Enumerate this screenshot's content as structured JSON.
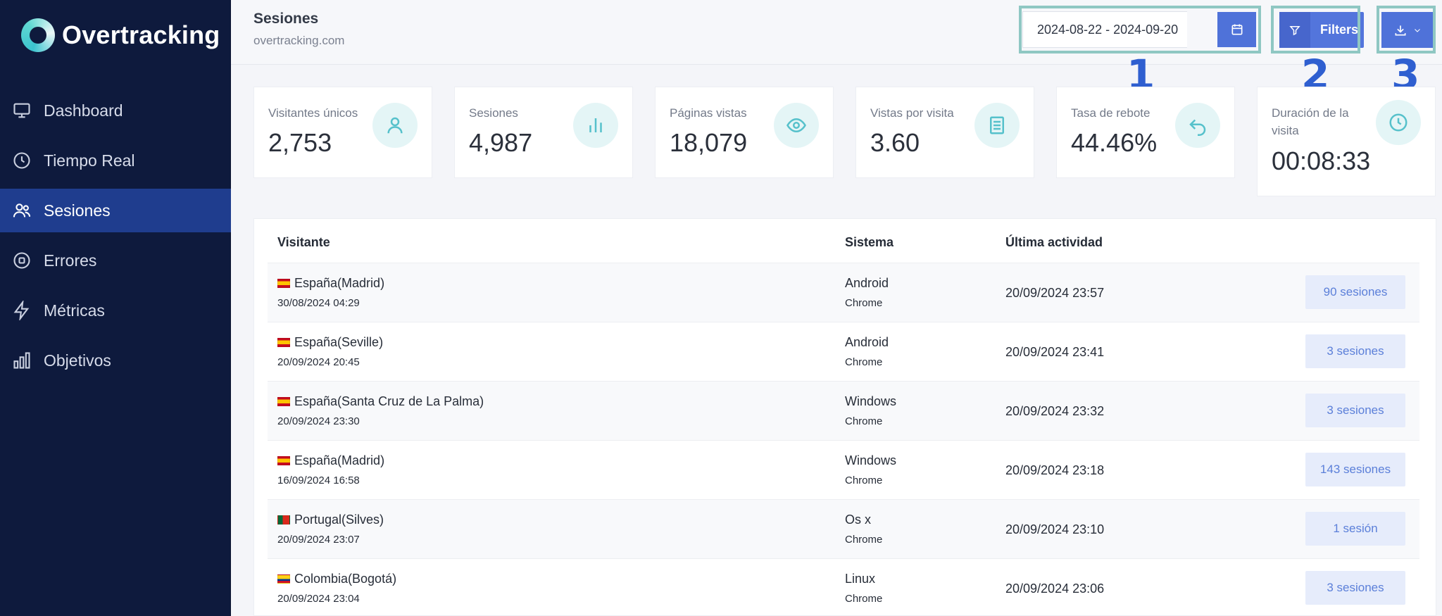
{
  "app": {
    "name": "Overtracking"
  },
  "sidebar": {
    "items": [
      {
        "label": "Dashboard",
        "icon": "monitor-icon"
      },
      {
        "label": "Tiempo Real",
        "icon": "clock-icon"
      },
      {
        "label": "Sesiones",
        "icon": "users-icon",
        "active": true
      },
      {
        "label": "Errores",
        "icon": "stop-circle-icon"
      },
      {
        "label": "Métricas",
        "icon": "lightning-icon"
      },
      {
        "label": "Objetivos",
        "icon": "bar-chart-icon"
      }
    ]
  },
  "header": {
    "title": "Sesiones",
    "subtitle": "overtracking.com",
    "date_range": "2024-08-22 - 2024-09-20",
    "filters_label": "Filters",
    "callouts": [
      "1",
      "2",
      "3"
    ]
  },
  "stats": [
    {
      "label": "Visitantes únicos",
      "value": "2,753",
      "icon": "user-icon"
    },
    {
      "label": "Sesiones",
      "value": "4,987",
      "icon": "bar-chart-icon"
    },
    {
      "label": "Páginas vistas",
      "value": "18,079",
      "icon": "eye-icon"
    },
    {
      "label": "Vistas por visita",
      "value": "3.60",
      "icon": "document-icon"
    },
    {
      "label": "Tasa de rebote",
      "value": "44.46%",
      "icon": "undo-icon"
    },
    {
      "label": "Duración de la visita",
      "value": "00:08:33",
      "icon": "clock-icon"
    }
  ],
  "table": {
    "headers": [
      "Visitante",
      "Sistema",
      "Última actividad"
    ],
    "rows": [
      {
        "flag": "es",
        "visitor": "España(Madrid)",
        "first_seen": "30/08/2024 04:29",
        "os": "Android",
        "browser": "Chrome",
        "last_activity": "20/09/2024 23:57",
        "sessions": "90 sesiones"
      },
      {
        "flag": "es",
        "visitor": "España(Seville)",
        "first_seen": "20/09/2024 20:45",
        "os": "Android",
        "browser": "Chrome",
        "last_activity": "20/09/2024 23:41",
        "sessions": "3 sesiones"
      },
      {
        "flag": "es",
        "visitor": "España(Santa Cruz de La Palma)",
        "first_seen": "20/09/2024 23:30",
        "os": "Windows",
        "browser": "Chrome",
        "last_activity": "20/09/2024 23:32",
        "sessions": "3 sesiones"
      },
      {
        "flag": "es",
        "visitor": "España(Madrid)",
        "first_seen": "16/09/2024 16:58",
        "os": "Windows",
        "browser": "Chrome",
        "last_activity": "20/09/2024 23:18",
        "sessions": "143 sesiones"
      },
      {
        "flag": "pt",
        "visitor": "Portugal(Silves)",
        "first_seen": "20/09/2024 23:07",
        "os": "Os x",
        "browser": "Chrome",
        "last_activity": "20/09/2024 23:10",
        "sessions": "1 sesión"
      },
      {
        "flag": "co",
        "visitor": "Colombia(Bogotá)",
        "first_seen": "20/09/2024 23:04",
        "os": "Linux",
        "browser": "Chrome",
        "last_activity": "20/09/2024 23:06",
        "sessions": "3 sesiones"
      }
    ]
  }
}
